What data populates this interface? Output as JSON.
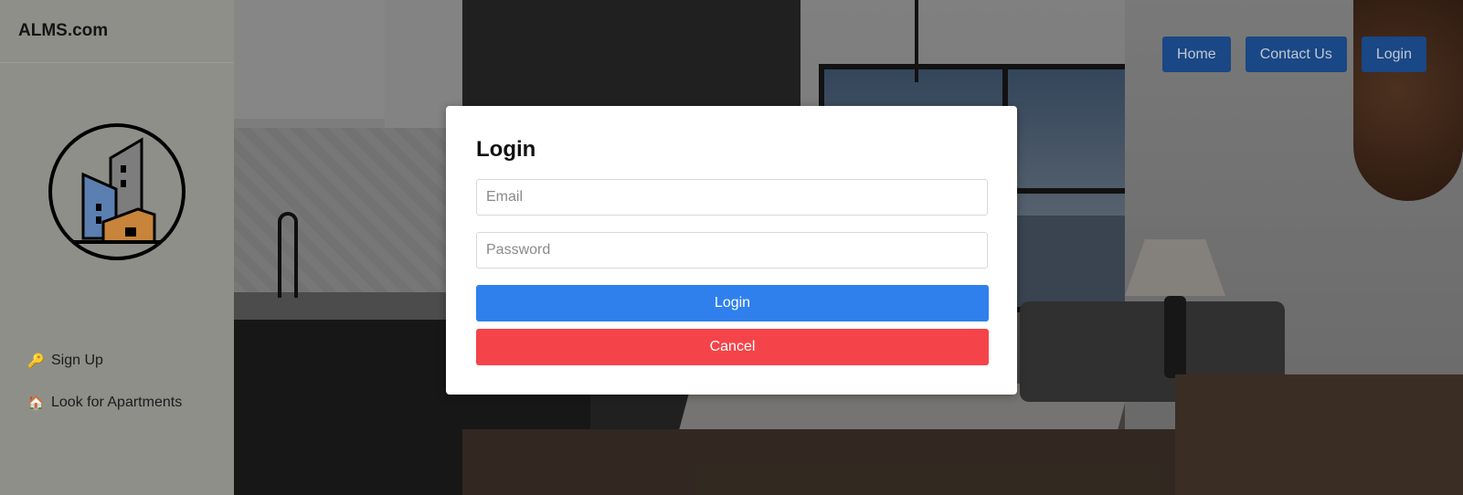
{
  "brand": {
    "name": "ALMS.com"
  },
  "sidebar": {
    "items": [
      {
        "label": "Sign Up",
        "icon": "key-icon"
      },
      {
        "label": "Look for Apartments",
        "icon": "house-icon"
      }
    ]
  },
  "topnav": {
    "items": [
      {
        "label": "Home"
      },
      {
        "label": "Contact Us"
      },
      {
        "label": "Login"
      }
    ]
  },
  "modal": {
    "title": "Login",
    "email_placeholder": "Email",
    "password_placeholder": "Password",
    "login_label": "Login",
    "cancel_label": "Cancel"
  },
  "colors": {
    "primary": "#2f80ed",
    "danger": "#f44449",
    "nav_button": "#1a4785"
  }
}
